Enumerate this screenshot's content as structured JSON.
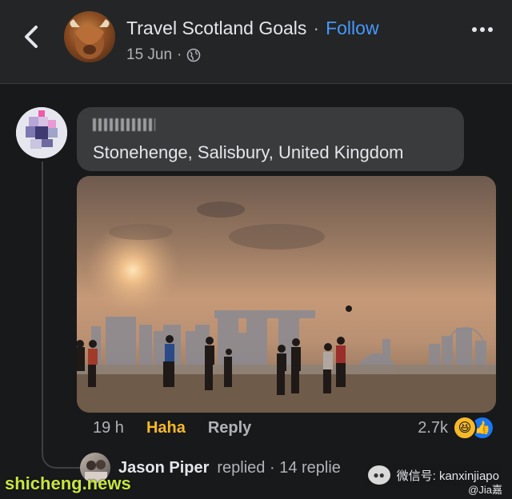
{
  "header": {
    "page_name": "Travel Scotland Goals",
    "separator": "·",
    "follow_label": "Follow",
    "post_date": "15 Jun",
    "audience_sep": "·"
  },
  "comment": {
    "text": "Stonehenge, Salisbury, United Kingdom",
    "time": "19 h",
    "reaction_label": "Haha",
    "reply_label": "Reply",
    "reaction_count": "2.7k",
    "reaction_icons": [
      "haha-icon",
      "like-icon"
    ]
  },
  "replies": {
    "replier_name": "Jason Piper",
    "replied_text": "replied · 14 replie"
  },
  "watermarks": {
    "site": "shicheng.news",
    "wechat_text": "微信号: kanxinjiapo",
    "handle": "@Jia嘉"
  },
  "colors": {
    "background": "#18191a",
    "header_bg": "#242526",
    "bubble_bg": "#3a3b3c",
    "follow_blue": "#4599ff",
    "haha_yellow": "#f7b928",
    "like_blue": "#1877f2",
    "watermark_green": "#c8e63c"
  }
}
